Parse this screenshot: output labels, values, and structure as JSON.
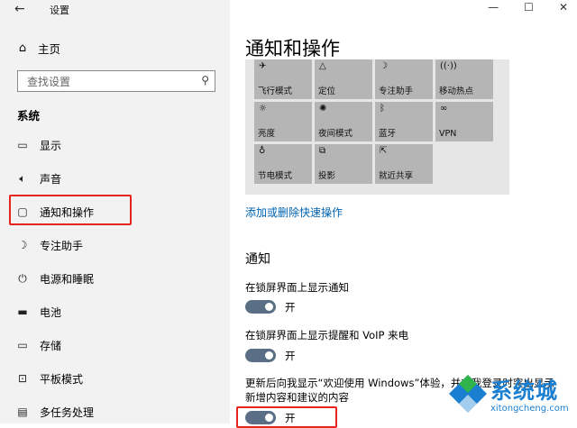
{
  "window": {
    "title": "设置",
    "back_glyph": "←",
    "minimize_glyph": "—",
    "maximize_glyph": "☐",
    "close_glyph": "✕"
  },
  "sidebar": {
    "home_label": "主页",
    "search_placeholder": "查找设置",
    "section_label": "系统",
    "items": [
      {
        "label": "显示",
        "icon": "display-icon"
      },
      {
        "label": "声音",
        "icon": "speaker-icon"
      },
      {
        "label": "通知和操作",
        "icon": "notification-icon",
        "selected": true
      },
      {
        "label": "专注助手",
        "icon": "moon-icon"
      },
      {
        "label": "电源和睡眠",
        "icon": "power-icon"
      },
      {
        "label": "电池",
        "icon": "battery-icon"
      },
      {
        "label": "存储",
        "icon": "storage-icon"
      },
      {
        "label": "平板模式",
        "icon": "tablet-icon"
      },
      {
        "label": "多任务处理",
        "icon": "multitask-icon"
      }
    ]
  },
  "main": {
    "title": "通知和操作",
    "quick_actions": [
      {
        "label": "飞行模式",
        "icon": "airplane-icon"
      },
      {
        "label": "定位",
        "icon": "location-icon"
      },
      {
        "label": "专注助手",
        "icon": "moon-icon"
      },
      {
        "label": "移动热点",
        "icon": "hotspot-icon"
      },
      {
        "label": "亮度",
        "icon": "sun-icon"
      },
      {
        "label": "夜间模式",
        "icon": "night-light-icon"
      },
      {
        "label": "蓝牙",
        "icon": "bluetooth-icon"
      },
      {
        "label": "VPN",
        "icon": "vpn-icon"
      },
      {
        "label": "节电模式",
        "icon": "battery-saver-icon"
      },
      {
        "label": "投影",
        "icon": "project-icon"
      },
      {
        "label": "就近共享",
        "icon": "share-icon"
      }
    ],
    "edit_link": "添加或删除快速操作",
    "notifications_heading": "通知",
    "settings": [
      {
        "label": "在锁屏界面上显示通知",
        "state": "开"
      },
      {
        "label": "在锁屏界面上显示提醒和 VoIP 来电",
        "state": "开"
      },
      {
        "label_line1": "更新后向我显示“欢迎使用 Windows”体验，并在我登录时突出显示",
        "label_line2": "新增内容和建议的内容",
        "state": "开"
      }
    ]
  },
  "watermark": {
    "text": "系统城",
    "url": "xitongcheng.com",
    "colors": [
      "#1b7fd1",
      "#2fb34a",
      "#ffffff"
    ]
  },
  "colors": {
    "accent": "#0078d7",
    "toggle_on": "#5a6f86",
    "highlight": "#e6241c",
    "link": "#0063b1"
  }
}
